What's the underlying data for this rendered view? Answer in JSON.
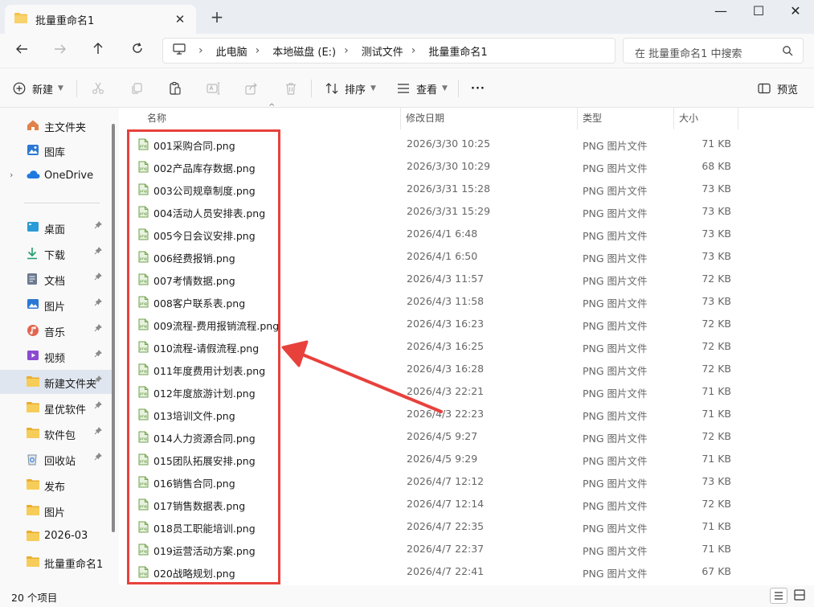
{
  "window": {
    "tab_title": "批量重命名1",
    "close_tab": "✕",
    "new_tab": "+",
    "minimize": "—",
    "maximize": "☐",
    "close": "✕"
  },
  "nav": {
    "breadcrumbs": [
      "此电脑",
      "本地磁盘 (E:)",
      "测试文件",
      "批量重命名1"
    ],
    "separator": "›",
    "search_placeholder": "在 批量重命名1 中搜索"
  },
  "toolbar": {
    "new_label": "新建",
    "sort_label": "排序",
    "view_label": "查看",
    "more_label": "···",
    "preview_label": "预览"
  },
  "sidebar": {
    "top_items": [
      {
        "label": "主文件夹",
        "icon": "home-icon"
      },
      {
        "label": "图库",
        "icon": "gallery-icon"
      },
      {
        "label": "OneDrive",
        "icon": "cloud-icon"
      }
    ],
    "pinned_items": [
      {
        "label": "桌面",
        "icon": "desktop-icon"
      },
      {
        "label": "下载",
        "icon": "download-icon"
      },
      {
        "label": "文档",
        "icon": "document-icon"
      },
      {
        "label": "图片",
        "icon": "pictures-icon"
      },
      {
        "label": "音乐",
        "icon": "music-icon"
      },
      {
        "label": "视频",
        "icon": "video-icon"
      },
      {
        "label": "新建文件夹",
        "icon": "folder-icon"
      },
      {
        "label": "星优软件",
        "icon": "folder-icon"
      },
      {
        "label": "软件包",
        "icon": "folder-icon"
      },
      {
        "label": "回收站",
        "icon": "recycle-bin-icon"
      },
      {
        "label": "发布",
        "icon": "folder-icon"
      },
      {
        "label": "图片",
        "icon": "folder-icon"
      },
      {
        "label": "2026-03",
        "icon": "folder-icon"
      },
      {
        "label": "批量重命名1",
        "icon": "folder-icon"
      }
    ]
  },
  "columns": {
    "name": "名称",
    "date": "修改日期",
    "type": "类型",
    "size": "大小"
  },
  "files": [
    {
      "name": "001采购合同.png",
      "date": "2026/3/30 10:25",
      "type": "PNG 图片文件",
      "size": "71 KB"
    },
    {
      "name": "002产品库存数据.png",
      "date": "2026/3/30 10:29",
      "type": "PNG 图片文件",
      "size": "68 KB"
    },
    {
      "name": "003公司规章制度.png",
      "date": "2026/3/31 15:28",
      "type": "PNG 图片文件",
      "size": "73 KB"
    },
    {
      "name": "004活动人员安排表.png",
      "date": "2026/3/31 15:29",
      "type": "PNG 图片文件",
      "size": "73 KB"
    },
    {
      "name": "005今日会议安排.png",
      "date": "2026/4/1 6:48",
      "type": "PNG 图片文件",
      "size": "73 KB"
    },
    {
      "name": "006经费报销.png",
      "date": "2026/4/1 6:50",
      "type": "PNG 图片文件",
      "size": "73 KB"
    },
    {
      "name": "007考情数据.png",
      "date": "2026/4/3 11:57",
      "type": "PNG 图片文件",
      "size": "72 KB"
    },
    {
      "name": "008客户联系表.png",
      "date": "2026/4/3 11:58",
      "type": "PNG 图片文件",
      "size": "73 KB"
    },
    {
      "name": "009流程-费用报销流程.png",
      "date": "2026/4/3 16:23",
      "type": "PNG 图片文件",
      "size": "72 KB"
    },
    {
      "name": "010流程-请假流程.png",
      "date": "2026/4/3 16:25",
      "type": "PNG 图片文件",
      "size": "72 KB"
    },
    {
      "name": "011年度费用计划表.png",
      "date": "2026/4/3 16:28",
      "type": "PNG 图片文件",
      "size": "72 KB"
    },
    {
      "name": "012年度旅游计划.png",
      "date": "2026/4/3 22:21",
      "type": "PNG 图片文件",
      "size": "71 KB"
    },
    {
      "name": "013培训文件.png",
      "date": "2026/4/3 22:23",
      "type": "PNG 图片文件",
      "size": "71 KB"
    },
    {
      "name": "014人力资源合同.png",
      "date": "2026/4/5 9:27",
      "type": "PNG 图片文件",
      "size": "72 KB"
    },
    {
      "name": "015团队拓展安排.png",
      "date": "2026/4/5 9:29",
      "type": "PNG 图片文件",
      "size": "71 KB"
    },
    {
      "name": "016销售合同.png",
      "date": "2026/4/7 12:12",
      "type": "PNG 图片文件",
      "size": "73 KB"
    },
    {
      "name": "017销售数据表.png",
      "date": "2026/4/7 12:14",
      "type": "PNG 图片文件",
      "size": "72 KB"
    },
    {
      "name": "018员工职能培训.png",
      "date": "2026/4/7 22:35",
      "type": "PNG 图片文件",
      "size": "71 KB"
    },
    {
      "name": "019运营活动方案.png",
      "date": "2026/4/7 22:37",
      "type": "PNG 图片文件",
      "size": "71 KB"
    },
    {
      "name": "020战略规划.png",
      "date": "2026/4/7 22:41",
      "type": "PNG 图片文件",
      "size": "67 KB"
    }
  ],
  "status": {
    "item_count": "20 个项目"
  },
  "colors": {
    "highlight": "#e8413c",
    "folder": "#f4c14a",
    "accent": "#1f6fd6"
  }
}
